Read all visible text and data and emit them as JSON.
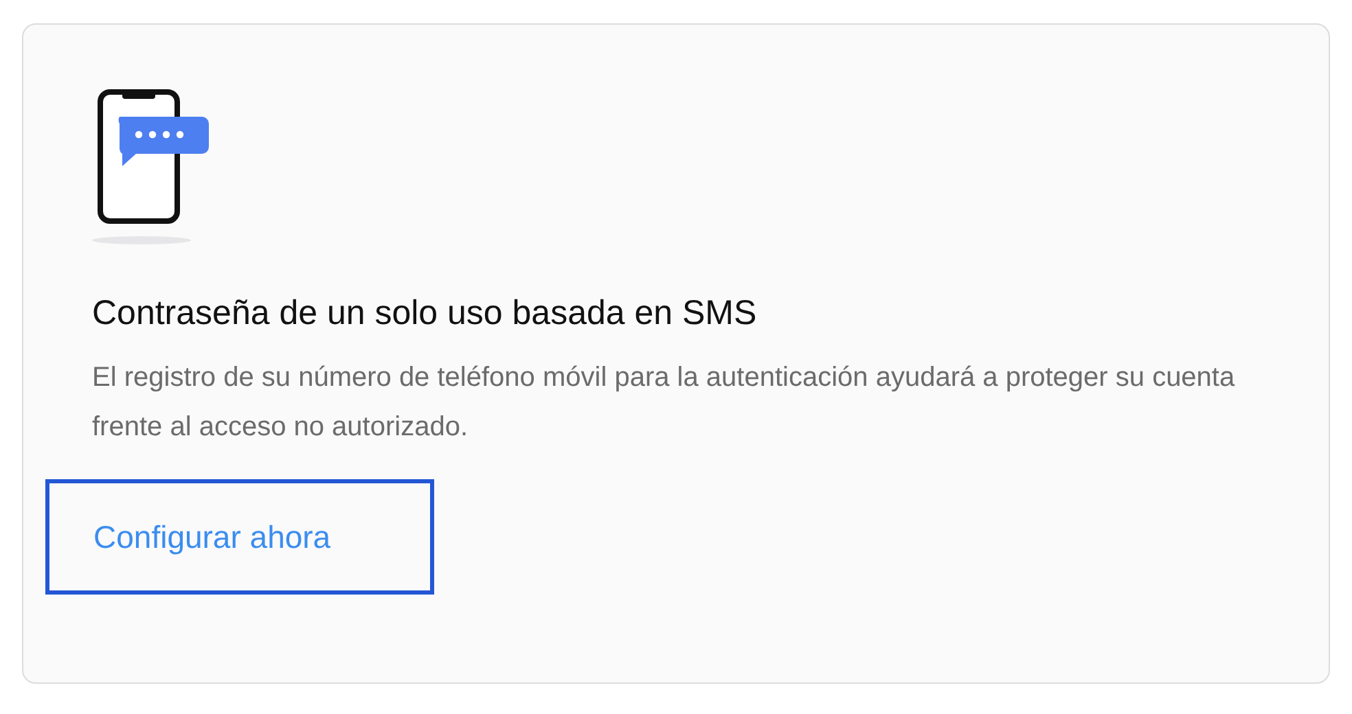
{
  "card": {
    "title": "Contraseña de un solo uso basada en SMS",
    "description": "El registro de su número de teléfono móvil para la autenticación ayudará a proteger su cuenta frente al acceso no autorizado.",
    "action": {
      "label": "Configurar ahora",
      "focused": true
    }
  }
}
